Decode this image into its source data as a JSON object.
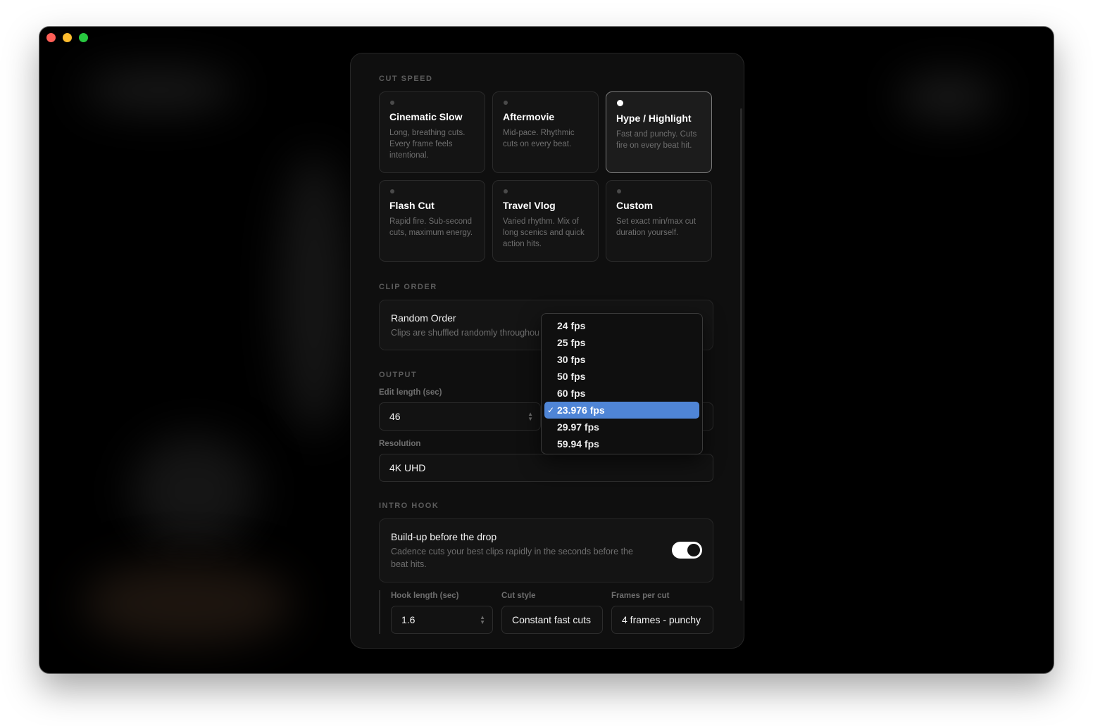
{
  "window": {
    "buttons": [
      "close",
      "minimize",
      "zoom"
    ]
  },
  "cut_speed": {
    "section_label": "CUT SPEED",
    "cards": [
      {
        "title": "Cinematic Slow",
        "desc": "Long, breathing cuts. Every frame feels intentional.",
        "selected": false
      },
      {
        "title": "Aftermovie",
        "desc": "Mid-pace. Rhythmic cuts on every beat.",
        "selected": false
      },
      {
        "title": "Hype / Highlight",
        "desc": "Fast and punchy. Cuts fire on every beat hit.",
        "selected": true
      },
      {
        "title": "Flash Cut",
        "desc": "Rapid fire. Sub-second cuts, maximum energy.",
        "selected": false
      },
      {
        "title": "Travel Vlog",
        "desc": "Varied rhythm. Mix of long scenics and quick action hits.",
        "selected": false
      },
      {
        "title": "Custom",
        "desc": "Set exact min/max cut duration yourself.",
        "selected": false
      }
    ]
  },
  "clip_order": {
    "section_label": "CLIP ORDER",
    "title": "Random Order",
    "desc": "Clips are shuffled randomly throughou"
  },
  "output": {
    "section_label": "OUTPUT",
    "edit_length_label": "Edit length (sec)",
    "edit_length_value": "46",
    "resolution_label": "Resolution",
    "resolution_value": "4K UHD"
  },
  "fps_dropdown": {
    "options": [
      "24 fps",
      "25 fps",
      "30 fps",
      "50 fps",
      "60 fps",
      "23.976 fps",
      "29.97 fps",
      "59.94 fps"
    ],
    "selected": "23.976 fps",
    "check": "✓"
  },
  "intro_hook": {
    "section_label": "INTRO HOOK",
    "title": "Build-up before the drop",
    "desc": "Cadence cuts your best clips rapidly in the seconds before the beat hits.",
    "enabled": true,
    "hook_length_label": "Hook length (sec)",
    "hook_length_value": "1.6",
    "cut_style_label": "Cut style",
    "cut_style_value": "Constant fast cuts",
    "frames_per_cut_label": "Frames per cut",
    "frames_per_cut_value": "4 frames - punchy"
  },
  "colors": {
    "accent": "#4f85d6",
    "background": "#000000",
    "panel": "#0f0f0f"
  }
}
